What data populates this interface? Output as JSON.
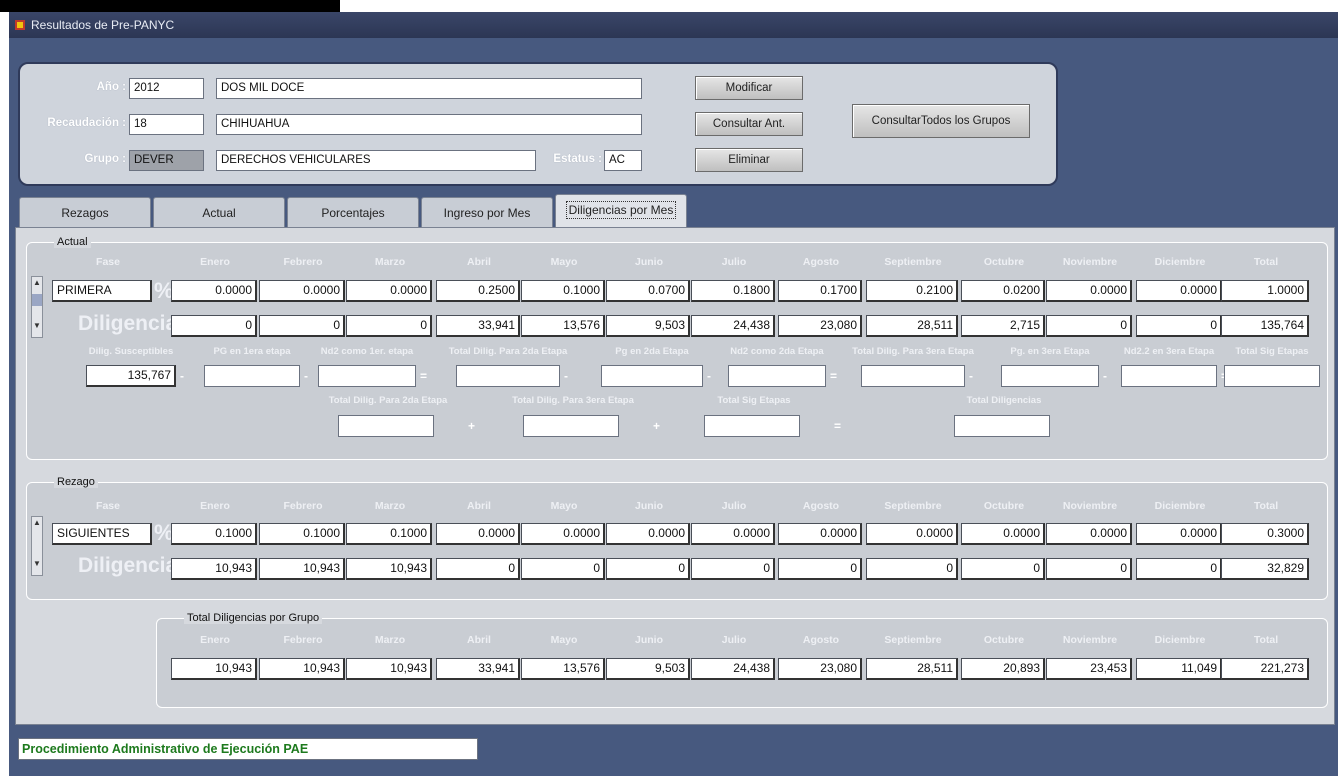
{
  "window": {
    "title": "Resultados de Pre-PANYC"
  },
  "header": {
    "anio_label": "Año :",
    "anio_value": "2012",
    "anio_desc": "DOS MIL DOCE",
    "recaudacion_label": "Recaudación :",
    "recaudacion_value": "18",
    "recaudacion_desc": "CHIHUAHUA",
    "grupo_label": "Grupo :",
    "grupo_value": "DEVER",
    "grupo_desc": "DERECHOS VEHICULARES",
    "estatus_label": "Estatus :",
    "estatus_value": "AC"
  },
  "buttons": {
    "modificar": "Modificar",
    "consultar_ant": "Consultar Ant.",
    "eliminar": "Eliminar",
    "consultar_todos": "ConsultarTodos los Grupos"
  },
  "tabs": [
    "Rezagos",
    "Actual",
    "Porcentajes",
    "Ingreso por Mes",
    "Diligencias por Mes"
  ],
  "months_header": [
    "Fase",
    "Enero",
    "Febrero",
    "Marzo",
    "Abril",
    "Mayo",
    "Junio",
    "Julio",
    "Agosto",
    "Septiembre",
    "Octubre",
    "Noviembre",
    "Diciembre",
    "Total"
  ],
  "actual": {
    "label": "Actual",
    "fase": "PRIMERA",
    "pct_symbol": "%",
    "pct": [
      "0.0000",
      "0.0000",
      "0.0000",
      "0.2500",
      "0.1000",
      "0.0700",
      "0.1800",
      "0.1700",
      "0.2100",
      "0.0200",
      "0.0000",
      "0.0000",
      "1.0000"
    ],
    "dil_label": "Diligencias",
    "dil": [
      "0",
      "0",
      "0",
      "33,941",
      "13,576",
      "9,503",
      "24,438",
      "23,080",
      "28,511",
      "2,715",
      "0",
      "0",
      "135,764"
    ],
    "calc_headers": [
      "Dilig. Susceptibles",
      "PG en 1era etapa",
      "Nd2 como 1er. etapa",
      "Total Dilig. Para 2da Etapa",
      "Pg en 2da Etapa",
      "Nd2 como 2da Etapa",
      "Total Dilig. Para 3era Etapa",
      "Pg. en 3era Etapa",
      "Nd2.2 en 3era Etapa",
      "Total Sig Etapas"
    ],
    "dilig_susceptibles": "135,767",
    "calc_ops": [
      "-",
      "-",
      "=",
      "-",
      "-",
      "=",
      "-",
      "-",
      "="
    ],
    "total_headers": [
      "Total Dilig. Para 2da Etapa",
      "Total Dilig. Para 3era Etapa",
      "Total Sig Etapas",
      "Total Diligencias"
    ],
    "total_ops": [
      "+",
      "+",
      "="
    ]
  },
  "rezago": {
    "label": "Rezago",
    "fase": "SIGUIENTES",
    "pct_symbol": "%",
    "pct": [
      "0.1000",
      "0.1000",
      "0.1000",
      "0.0000",
      "0.0000",
      "0.0000",
      "0.0000",
      "0.0000",
      "0.0000",
      "0.0000",
      "0.0000",
      "0.0000",
      "0.3000"
    ],
    "dil_label": "Diligencias",
    "dil": [
      "10,943",
      "10,943",
      "10,943",
      "0",
      "0",
      "0",
      "0",
      "0",
      "0",
      "0",
      "0",
      "0",
      "32,829"
    ]
  },
  "total_grupo": {
    "label": "Total Diligencias por Grupo",
    "values": [
      "10,943",
      "10,943",
      "10,943",
      "33,941",
      "13,576",
      "9,503",
      "24,438",
      "23,080",
      "28,511",
      "20,893",
      "23,453",
      "11,049",
      "221,273"
    ]
  },
  "status": "Procedimiento Administrativo de Ejecución  PAE"
}
